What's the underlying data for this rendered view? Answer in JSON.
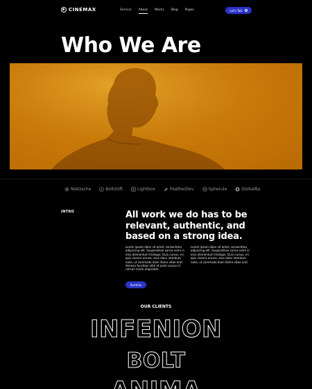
{
  "brand": {
    "name": "CINEMAX",
    "icon": "logo-circle-icon"
  },
  "nav": {
    "items": [
      {
        "label": "Service",
        "active": false
      },
      {
        "label": "About",
        "active": true
      },
      {
        "label": "Works",
        "active": false
      },
      {
        "label": "Blog",
        "active": false
      },
      {
        "label": "Pages",
        "active": false
      }
    ]
  },
  "cta": {
    "label": "Let's Talk",
    "icon": "search-icon",
    "color": "#2a34c7"
  },
  "hero": {
    "title": "Who We Are",
    "image_tint": "#c97a08"
  },
  "partners": [
    {
      "label": "Nietzsche",
      "icon": "sun-icon"
    },
    {
      "label": "Boltshift",
      "icon": "bolt-icon"
    },
    {
      "label": "Lightbox",
      "icon": "lightbox-icon"
    },
    {
      "label": "FeatherDev",
      "icon": "feather-icon"
    },
    {
      "label": "Spherule",
      "icon": "sphere-icon"
    },
    {
      "label": "GlobalBa",
      "icon": "globe-icon"
    }
  ],
  "intro": {
    "label": "INTRO",
    "heading": "All work we do has to be relevant, authentic, and based on a strong idea.",
    "para_left": "Lorem ipsum dolor sit amet, consectetur adipiscing elit. Suspendisse varius enim in eros elementum tristique. Duis cursus, mi quis viverra ornare, eros dolor interdum nulla, ut commodo diam libero vitae erat. Aenean faucibus nibh et justo cursus id rutrum lorem imperdiet.",
    "para_right": "Lorem ipsum dolor sit amet, consectetur adipiscing elit. Suspendisse varius enim in eros elementum tristique. Duis cursus, mi quis viverra ornare, eros dolor interdum nulla, ut commodo diam libero vitae erat.",
    "button_label": "Portfolio"
  },
  "clients": {
    "label": "OUR CLIENTS",
    "names": [
      "INFENION",
      "BOLT",
      "ANIMA"
    ]
  }
}
